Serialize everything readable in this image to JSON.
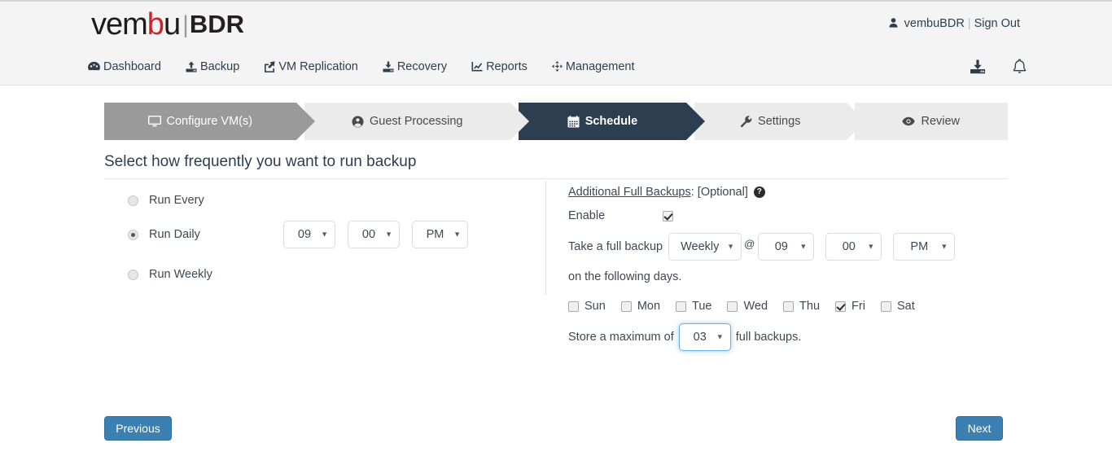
{
  "header": {
    "logo": {
      "part1": "vem",
      "part2": "b",
      "part3": "u",
      "separator": "|",
      "product": "BDR"
    },
    "account": {
      "icon": "user-icon",
      "username": "vembuBDR",
      "separator": "|",
      "signout": "Sign Out"
    }
  },
  "nav": {
    "items": [
      {
        "label": "Dashboard",
        "icon": "dashboard-icon"
      },
      {
        "label": "Backup",
        "icon": "upload-icon"
      },
      {
        "label": "VM Replication",
        "icon": "share-square-icon"
      },
      {
        "label": "Recovery",
        "icon": "download-icon"
      },
      {
        "label": "Reports",
        "icon": "chart-line-icon"
      },
      {
        "label": "Management",
        "icon": "arrows-icon"
      }
    ],
    "right_icons": [
      {
        "name": "download-inbox-icon"
      },
      {
        "name": "bell-icon"
      }
    ]
  },
  "wizard": {
    "steps": [
      {
        "label": "Configure VM(s)",
        "icon": "desktop-icon",
        "state": "done"
      },
      {
        "label": "Guest Processing",
        "icon": "user-circle-icon",
        "state": "upcoming"
      },
      {
        "label": "Schedule",
        "icon": "calendar-icon",
        "state": "active"
      },
      {
        "label": "Settings",
        "icon": "wrench-icon",
        "state": "upcoming"
      },
      {
        "label": "Review",
        "icon": "eye-icon",
        "state": "upcoming"
      }
    ],
    "active_color": "#2c3e50",
    "done_color": "#9a9a9a",
    "upcoming_color": "#ebebeb"
  },
  "page": {
    "title": "Select how frequently you want to run backup"
  },
  "frequency": {
    "options": [
      {
        "label": "Run Every",
        "selected": false
      },
      {
        "label": "Run Daily",
        "selected": true
      },
      {
        "label": "Run Weekly",
        "selected": false
      }
    ],
    "daily_time": {
      "hour": "09",
      "minute": "00",
      "meridiem": "PM"
    }
  },
  "additional_full_backups": {
    "title": "Additional Full Backups",
    "title_suffix": ": [Optional]",
    "help_icon": "question-circle-icon",
    "enable_label": "Enable",
    "enable_checked": true,
    "take_full_backup_label": "Take a full backup",
    "interval": "Weekly",
    "at_symbol": "@",
    "time": {
      "hour": "09",
      "minute": "00",
      "meridiem": "PM"
    },
    "on_following_days_label": "on the following days.",
    "days": [
      {
        "label": "Sun",
        "checked": false
      },
      {
        "label": "Mon",
        "checked": false
      },
      {
        "label": "Tue",
        "checked": false
      },
      {
        "label": "Wed",
        "checked": false
      },
      {
        "label": "Thu",
        "checked": false
      },
      {
        "label": "Fri",
        "checked": true
      },
      {
        "label": "Sat",
        "checked": false
      }
    ],
    "store_max_prefix": "Store a maximum of",
    "store_max_value": "03",
    "store_max_suffix": "full backups.",
    "store_max_focused": true
  },
  "footer": {
    "previous_label": "Previous",
    "next_label": "Next",
    "button_color": "#3c7fb1"
  }
}
